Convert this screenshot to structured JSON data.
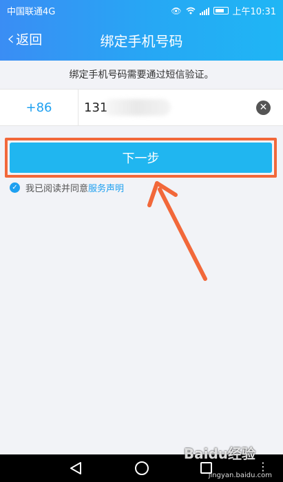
{
  "status_bar": {
    "carrier": "中国联通4G",
    "network_badge": "4G",
    "time": "上午10:31",
    "icons": [
      "eye-icon",
      "wifi-icon",
      "signal-icon",
      "battery-icon"
    ]
  },
  "header": {
    "back_label": "返回",
    "title": "绑定手机号码"
  },
  "notice": "绑定手机号码需要通过短信验证。",
  "phone": {
    "country_code": "+86",
    "value": "131",
    "placeholder": "",
    "clear_icon": "clear-icon"
  },
  "next_button": {
    "label": "下一步"
  },
  "agreement": {
    "checked": true,
    "prefix": "我已阅读并同意",
    "link": "服务声明"
  },
  "watermark": {
    "brand": "Baidu经验",
    "url": "jingyan.baidu.com"
  },
  "colors": {
    "header_start": "#3a8df4",
    "header_end": "#1fb6f5",
    "accent": "#1ea0f0",
    "button": "#20b6f0",
    "highlight": "#f2683a",
    "background": "#f2f3f7"
  }
}
